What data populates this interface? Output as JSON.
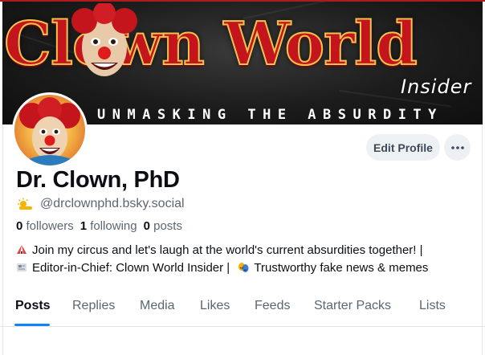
{
  "banner": {
    "title": "Clown World",
    "subtitle": "Insider",
    "tagline": "UNMASKING THE ABSURDITY"
  },
  "profile": {
    "display_name": "Dr. Clown, PhD",
    "handle": "@drclownphd.bsky.social",
    "handle_icon": "sun-cloud-icon",
    "stats": {
      "followers_count": "0",
      "followers_label": "followers",
      "following_count": "1",
      "following_label": "following",
      "posts_count": "0",
      "posts_label": "posts"
    },
    "bio": {
      "line1": "Join my circus and let's laugh at the world's current absurdities together! |",
      "line2_a": "Editor-in-Chief: Clown World Insider |",
      "line2_b": "Trustworthy fake news & memes"
    }
  },
  "actions": {
    "edit_profile": "Edit Profile",
    "more_icon": "ellipsis-icon"
  },
  "tabs": [
    {
      "label": "Posts",
      "active": true
    },
    {
      "label": "Replies"
    },
    {
      "label": "Media"
    },
    {
      "label": "Likes"
    },
    {
      "label": "Feeds"
    },
    {
      "label": "Starter Packs"
    },
    {
      "label": "Lists"
    }
  ],
  "colors": {
    "accent": "#1083fe",
    "banner_red": "#c4151c",
    "banner_gold": "#f2c14e"
  }
}
